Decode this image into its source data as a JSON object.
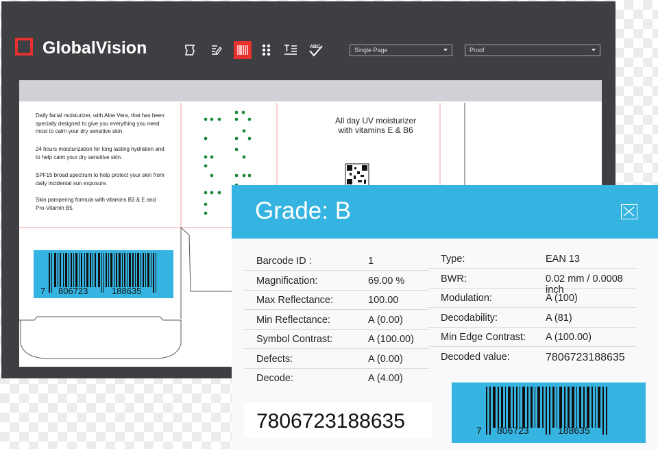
{
  "app": {
    "logo_text": "GlobalVision",
    "brand_color": "#e8312f",
    "toolbar_icons": [
      "artwork-icon",
      "text-compare-icon",
      "barcode-icon",
      "braille-icon",
      "text-format-icon",
      "spellcheck-icon"
    ],
    "spellcheck_label": "ABC",
    "view_mode": "Single Page",
    "proof_mode": "Proof"
  },
  "document": {
    "paragraphs": [
      "Daily facial moisturizer, with Aloe Vera, that has been specially designed to give you everything you need most to calm your dry sensitive skin.",
      "24 hours moisturization for long lasting hydration and to help calm your dry sensitive skin.",
      "SPF15 broad spectrum to help protect your skin from daily incidental sun exposure.",
      "Skin pampering formula with vitamins B3 & E and Pro-Vitamin B5."
    ],
    "artwork_title_line1": "All day UV moisturizer",
    "artwork_title_line2": "with vitamins E & B6",
    "barcode_digits_left": "7",
    "barcode_digits_mid": "806723",
    "barcode_digits_right": "188635"
  },
  "panel": {
    "grade": "Grade: B",
    "accent_color": "#36b4e1",
    "left_rows": [
      {
        "key": "Barcode ID     :",
        "value": "1"
      },
      {
        "key": "Magnification:",
        "value": "69.00 %"
      },
      {
        "key": "Max Reflectance:",
        "value": "100.00"
      },
      {
        "key": "Min Reflectance:",
        "value": "A (0.00)"
      },
      {
        "key": "Symbol Contrast:",
        "value": "A (100.00)"
      },
      {
        "key": "Defects:",
        "value": "A (0.00)"
      },
      {
        "key": "Decode:",
        "value": "A (4.00)"
      }
    ],
    "right_rows": [
      {
        "key": "Type:",
        "value": "EAN 13"
      },
      {
        "key": "BWR:",
        "value": "0.02 mm / 0.0008 inch"
      },
      {
        "key": "Modulation:",
        "value": "A (100)"
      },
      {
        "key": "Decodability:",
        "value": "A (81)"
      },
      {
        "key": "Min Edge Contrast:",
        "value": "A (100.00)"
      },
      {
        "key": "Decoded value:",
        "value": "7806723188635"
      }
    ],
    "decoded_big": "7806723188635",
    "barcode_digits_left": "7",
    "barcode_digits_mid": "806723",
    "barcode_digits_right": "188635"
  }
}
